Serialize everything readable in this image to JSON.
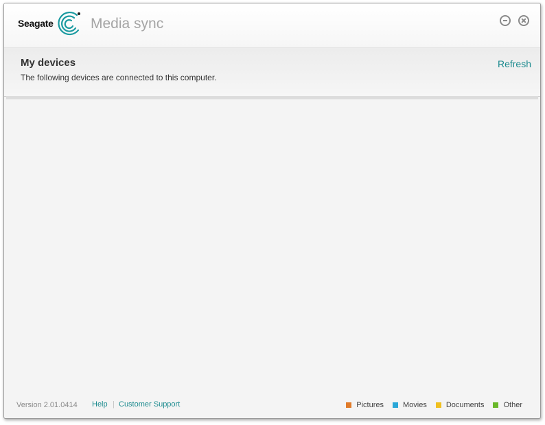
{
  "window": {
    "brand": "Seagate",
    "app_title": "Media sync"
  },
  "header": {
    "title": "My devices",
    "subtitle": "The following devices are connected to this computer.",
    "refresh_label": "Refresh"
  },
  "footer": {
    "version": "Version 2.01.0414",
    "help_label": "Help",
    "separator": "|",
    "support_label": "Customer Support",
    "legend": [
      {
        "label": "Pictures",
        "color": "#e07b2a"
      },
      {
        "label": "Movies",
        "color": "#2aa7d8"
      },
      {
        "label": "Documents",
        "color": "#f0c020"
      },
      {
        "label": "Other",
        "color": "#6ab82a"
      }
    ]
  },
  "colors": {
    "accent": "#1a8a8e",
    "brand_mark": "#1a9aa0"
  }
}
